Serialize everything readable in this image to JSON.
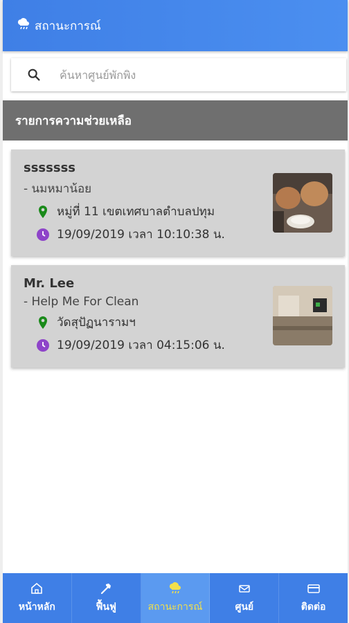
{
  "header": {
    "title": "สถานะการณ์",
    "icon": "weather-icon"
  },
  "search": {
    "placeholder": "ค้นหาศูนย์พักพิง"
  },
  "section": {
    "title": "รายการความช่วยเหลือ"
  },
  "items": [
    {
      "name": "sssssss",
      "description": "- นมหมาน้อย",
      "location": "หมู่ที่ 11 เขตเทศบาลตำบลปทุม",
      "datetime": "19/09/2019 เวลา 10:10:38 น."
    },
    {
      "name": "Mr. Lee",
      "description": "- Help Me For Clean",
      "location": "วัดสุปัฏนารามฯ",
      "datetime": "19/09/2019 เวลา 04:15:06 น."
    }
  ],
  "nav": {
    "tabs": [
      {
        "label": "หน้าหลัก",
        "icon": "home-icon"
      },
      {
        "label": "ฟื้นฟู",
        "icon": "hammer-icon"
      },
      {
        "label": "สถานะการณ์",
        "icon": "weather-icon"
      },
      {
        "label": "ศูนย์",
        "icon": "mail-icon"
      },
      {
        "label": "ติดต่อ",
        "icon": "card-icon"
      }
    ],
    "active_index": 2
  },
  "colors": {
    "primary": "#3f7fe6",
    "active_text": "#f3e04a",
    "pin": "#1a8a1a",
    "clock": "#8e44c9"
  }
}
